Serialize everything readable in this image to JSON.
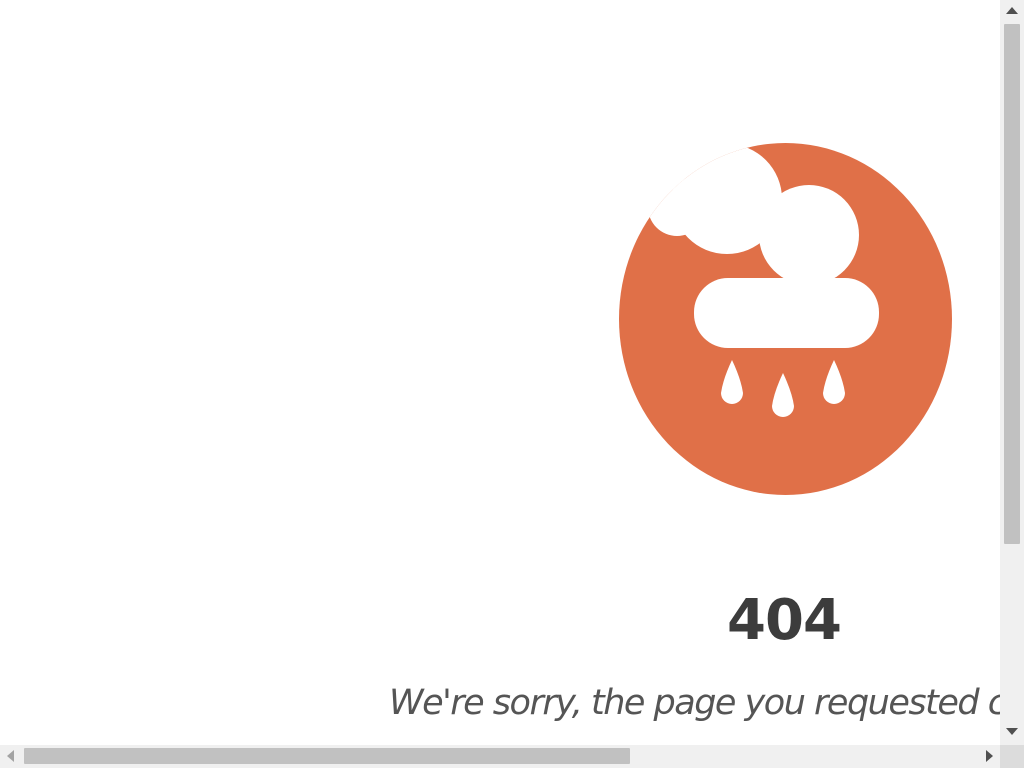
{
  "error_page": {
    "code": "404",
    "message": "We're sorry, the page you requested cannot be found",
    "icon": "rain-cloud-icon"
  },
  "colors": {
    "accent": "#e07048",
    "icon_fill": "#ffffff",
    "code_text": "#3c3c3c",
    "message_text": "#555555",
    "background": "#ffffff"
  },
  "scrollbars": {
    "vertical": "visible",
    "horizontal": "visible"
  }
}
